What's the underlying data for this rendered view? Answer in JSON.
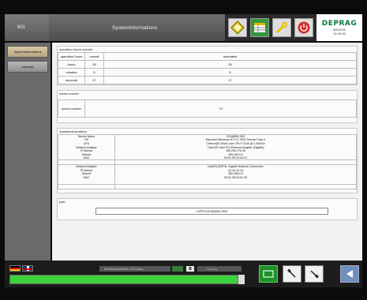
{
  "header": {
    "number": "601",
    "title": "Systeminformations",
    "logo_name": "DEPRAG",
    "date": "6/5/2015",
    "time": "14:29:45"
  },
  "nav": {
    "items": [
      {
        "label": "Systeminformations",
        "active": true
      },
      {
        "label": "manuals",
        "active": false
      }
    ]
  },
  "operation_hours": {
    "title": "operation hours counter",
    "headers": [
      "operation hours",
      "overall",
      "resettable"
    ],
    "rows": [
      {
        "label": "hours",
        "overall": "39",
        "resettable": "39"
      },
      {
        "label": "minutes",
        "overall": "5",
        "resettable": "5"
      },
      {
        "label": "seconds",
        "overall": "17",
        "resettable": "17"
      }
    ]
  },
  "screw_counter": {
    "title": "screw counter",
    "label": "screw counter",
    "value": "73"
  },
  "sysinfo": {
    "title": "Systeminformations",
    "rows": [
      {
        "k": "Device Name",
        "v": "32168952-903"
      },
      {
        "k": "OS",
        "v": "Microsoft Windows NT 6.1.7601 Service Pack 1"
      },
      {
        "k": "CPU",
        "v": "Celeron(R) Dual-Core CPU   T3100 @ 1.90GHz"
      },
      {
        "k": "Network Adapter",
        "v": "TwinCAT-Intel PCI Ethernet Adapter (Gigabit)"
      },
      {
        "k": "IP Adress",
        "v": "169.254.176.26"
      },
      {
        "k": "Subnet",
        "v": "255.255.0.0"
      },
      {
        "k": "MAC",
        "v": "00:01:05:24:44:7C"
      },
      {
        "k": "",
        "v": ""
      },
      {
        "k": "Network Adapter",
        "v": "Intel(R) 82574L Gigabit Network Connection"
      },
      {
        "k": "IP Adress",
        "v": "10.10.10.15"
      },
      {
        "k": "Subnet",
        "v": "255.255.0.0"
      },
      {
        "k": "MAC",
        "v": "00:01:05:24:44:7D"
      }
    ]
  },
  "path": {
    "title": "path",
    "value": "c:\\PP\\132168952-903\\"
  },
  "bottom": {
    "status_text": "MiniRequestTime: 974.08us",
    "status_icon": "B",
    "status_right": "Deprag",
    "progress_percent": 100,
    "colors": {
      "progress": "#3cd23c",
      "accent_green": "#1f8f2a",
      "back_blue": "#6f8fbf"
    }
  }
}
